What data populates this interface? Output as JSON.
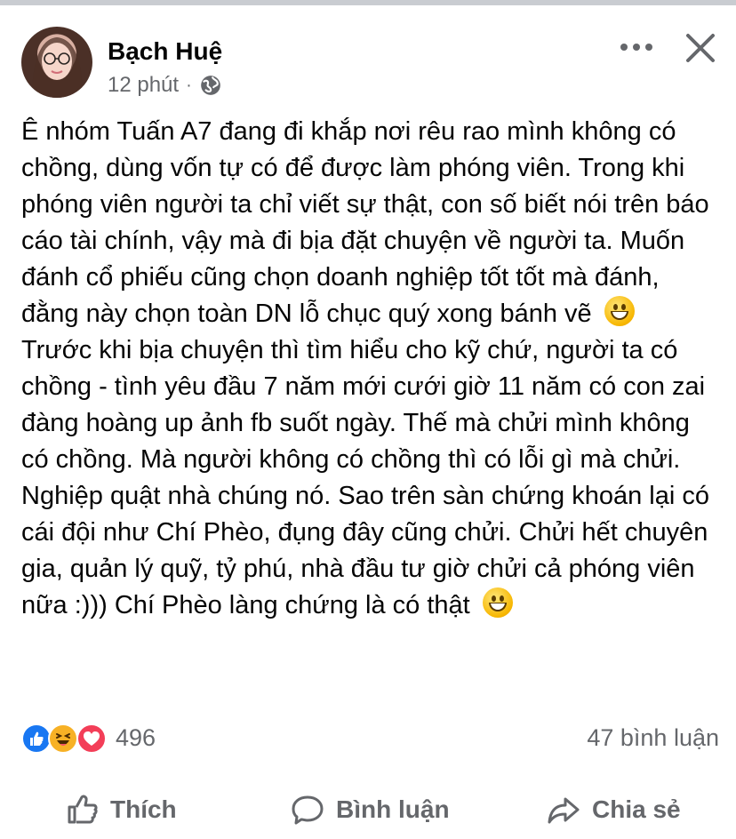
{
  "post": {
    "author_name": "Bạch Huệ",
    "time": "12 phút",
    "separator": "·",
    "privacy_icon": "globe-icon",
    "text_paragraphs": [
      "Ê nhóm Tuấn A7 đang đi khắp nơi rêu rao mình không có chồng, dùng vốn tự có để được làm phóng viên. Trong khi phóng viên người ta chỉ viết sự thật, con số biết nói trên báo cáo tài chính, vậy mà đi bịa đặt chuyện về người ta. Muốn đánh cổ phiếu cũng chọn doanh nghiệp tốt tốt mà đánh, đằng này chọn toàn DN lỗ chục quý xong bánh vẽ",
      "Trước khi bịa chuyện thì tìm hiểu cho kỹ chứ, người ta có chồng - tình yêu đầu 7 năm mới cưới giờ 11 năm có con zai đàng hoàng up ảnh fb suốt ngày. Thế mà chửi mình không có chồng. Mà người không có chồng thì có lỗi gì mà chửi. Nghiệp quật nhà chúng nó. Sao trên sàn chứng khoán lại có cái đội như Chí Phèo, đụng đây cũng chửi. Chửi hết chuyên gia, quản lý quỹ, tỷ phú, nhà đầu tư giờ chửi cả phóng viên nữa :))) Chí Phèo làng chứng là có thật"
    ],
    "emoji": "grinning-face-emoji"
  },
  "reactions": {
    "icons": [
      "like-icon",
      "haha-icon",
      "love-icon"
    ],
    "count": "496",
    "comments": "47 bình luận"
  },
  "actions": {
    "like_label": "Thích",
    "comment_label": "Bình luận",
    "share_label": "Chia sẻ"
  },
  "colors": {
    "text": "#050505",
    "secondary": "#65676b",
    "like_blue": "#1877f2",
    "love_red": "#f33e58",
    "haha_yellow": "#f7b125"
  }
}
